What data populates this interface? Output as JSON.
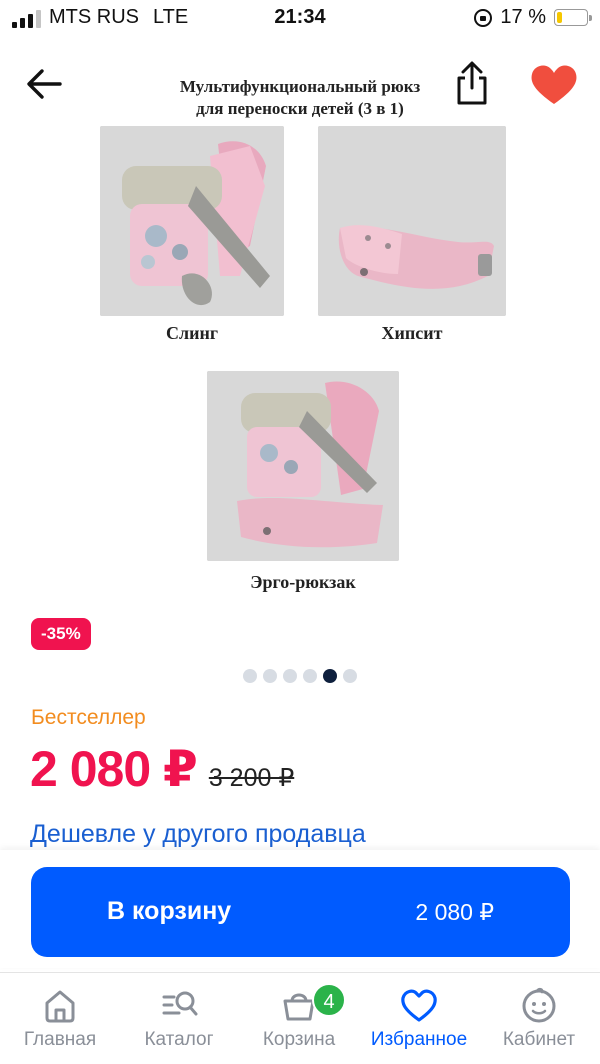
{
  "status_bar": {
    "carrier": "MTS RUS",
    "network": "LTE",
    "time": "21:34",
    "battery_percent": "17 %",
    "battery_level": 0.17,
    "battery_color": "#f6c700"
  },
  "header": {
    "back_icon": "arrow-left-icon",
    "share_icon": "share-icon",
    "favorite_icon": "heart-icon",
    "favorite_color": "#f04e3e"
  },
  "gallery": {
    "title_line1": "Мультифункциональный рюкз",
    "title_line2": "для переноски детей (3 в 1)",
    "captions": {
      "sling": "Слинг",
      "hipseat": "Хипсит",
      "ergo": "Эрго-рюкзак"
    },
    "slide_count": 6,
    "active_slide_index": 4
  },
  "product": {
    "discount": "-35%",
    "badge": "Бестселлер",
    "price": "2 080 ₽",
    "old_price": "3 200 ₽",
    "cheaper_link": "Дешевле у другого продавца"
  },
  "buy_bar": {
    "cart_button_label": "В корзину",
    "cart_button_price": "2 080 ₽"
  },
  "tab_bar": {
    "tabs": [
      {
        "label": "Главная",
        "icon": "home-icon"
      },
      {
        "label": "Каталог",
        "icon": "catalog-search-icon"
      },
      {
        "label": "Корзина",
        "icon": "cart-icon"
      },
      {
        "label": "Избранное",
        "icon": "heart-icon"
      },
      {
        "label": "Кабинет",
        "icon": "smiley-face-icon"
      }
    ],
    "cart_count": "4",
    "active_tab": "Избранное",
    "accent": "#005bff"
  },
  "colors": {
    "price": "#f0134f",
    "bestseller": "#f28c1f",
    "link": "#1a5fd1",
    "primary_button": "#005bff"
  }
}
